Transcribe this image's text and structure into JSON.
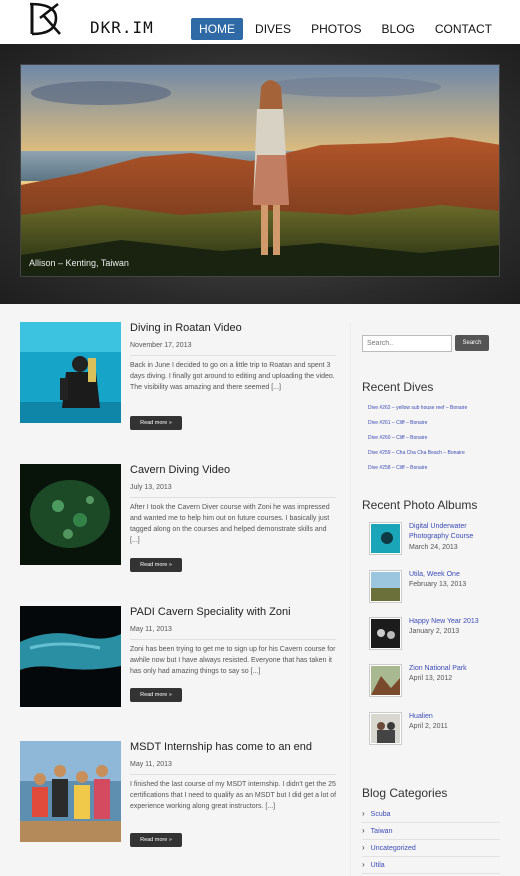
{
  "site": {
    "logo_text": "DKR.IM"
  },
  "nav": [
    {
      "label": "HOME",
      "active": true
    },
    {
      "label": "DIVES",
      "active": false
    },
    {
      "label": "PHOTOS",
      "active": false
    },
    {
      "label": "BLOG",
      "active": false
    },
    {
      "label": "CONTACT",
      "active": false
    }
  ],
  "slider": {
    "caption": "Allison – Kenting, Taiwan"
  },
  "posts": [
    {
      "title": "Diving in Roatan Video",
      "date": "November 17, 2013",
      "excerpt": "Back in June I decided to go on a little trip to Roatan and spent 3 days diving. I finally got around to editing and uploading the video. The visibility was amazing and there seemed [...]",
      "readmore": "Read more »"
    },
    {
      "title": "Cavern Diving Video",
      "date": "July 13, 2013",
      "excerpt": "After I took the Cavern Diver course with Zoni he was impressed and wanted me to help him out on future courses. I basically just tagged along on the courses and helped demonstrate skills and [...]",
      "readmore": "Read more »"
    },
    {
      "title": "PADI Cavern Speciality with Zoni",
      "date": "May 11, 2013",
      "excerpt": "Zoni has been trying to get me to sign up for his Cavern course for awhile now but I have always resisted. Everyone that has taken it has only had amazing things to say so [...]",
      "readmore": "Read more »"
    },
    {
      "title": "MSDT Internship has come to an end",
      "date": "May 11, 2013",
      "excerpt": "I finished the last course of my MSDT internship. I didn't get the 25 certifications that I need to qualify as an MSDT but I did get a lot of experience working along great instructors. [...]",
      "readmore": "Read more »"
    }
  ],
  "sidebar": {
    "search_placeholder": "Search..",
    "search_button": "Search",
    "recent_dives_title": "Recent Dives",
    "recent_dives": [
      "Dive #262 – yellow sub house reef – Bonaire",
      "Dive #261 – Cliff – Bonaire",
      "Dive #260 – Cliff – Bonaire",
      "Dive #259 – Cha Cha Cha Beach – Bonaire",
      "Dive #258 – Cliff – Bonaire"
    ],
    "recent_albums_title": "Recent Photo Albums",
    "recent_albums": [
      {
        "name": "Digital Underwater Photography Course",
        "date": "March 24, 2013"
      },
      {
        "name": "Utila, Week One",
        "date": "February 13, 2013"
      },
      {
        "name": "Happy New Year 2013",
        "date": "January 2, 2013"
      },
      {
        "name": "Zion National Park",
        "date": "April 13, 2012"
      },
      {
        "name": "Hualien",
        "date": "April 2, 2011"
      }
    ],
    "categories_title": "Blog Categories",
    "categories": [
      "Scuba",
      "Taiwan",
      "Uncategorized",
      "Utila"
    ]
  }
}
